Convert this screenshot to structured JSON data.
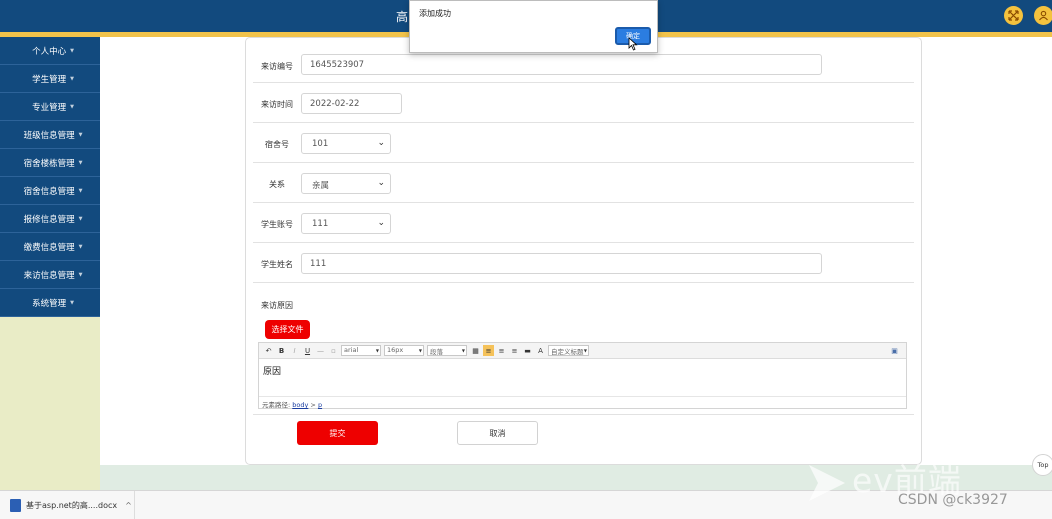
{
  "header": {
    "app_title": "高"
  },
  "sidebar": {
    "items": [
      {
        "label": "个人中心"
      },
      {
        "label": "学生管理"
      },
      {
        "label": "专业管理"
      },
      {
        "label": "班级信息管理"
      },
      {
        "label": "宿舍楼栋管理"
      },
      {
        "label": "宿舍信息管理"
      },
      {
        "label": "报修信息管理"
      },
      {
        "label": "缴费信息管理"
      },
      {
        "label": "来访信息管理"
      },
      {
        "label": "系统管理"
      }
    ]
  },
  "form": {
    "visit_no": {
      "label": "来访编号",
      "value": "1645523907"
    },
    "visit_time": {
      "label": "来访时间",
      "value": "2022-02-22"
    },
    "dorm_no": {
      "label": "宿舍号",
      "value": "101"
    },
    "relation": {
      "label": "关系",
      "value": "亲属"
    },
    "student_account": {
      "label": "学生账号",
      "value": "111"
    },
    "student_name": {
      "label": "学生姓名",
      "value": "111"
    },
    "reason": {
      "label": "来访原因"
    },
    "choose_file_label": "选择文件",
    "submit_label": "提交",
    "cancel_label": "取消"
  },
  "editor": {
    "font_family": "arial",
    "font_size": "16px",
    "paragraph": "段落",
    "custom_title": "自定义标题",
    "content": "原因",
    "path_prefix": "元素路径:",
    "path_body": "body",
    "path_sep": " > ",
    "path_p": "p"
  },
  "dialog": {
    "message": "添加成功",
    "ok_label": "确定"
  },
  "taskbar": {
    "download_name": "基于asp.net的高....docx"
  },
  "back_to_top": "Top",
  "watermark": {
    "logo_text": "ev前端",
    "csdn_text": "CSDN @ck3927"
  },
  "colors": {
    "header_bg": "#124a7e",
    "accent_red": "#ee0000",
    "stripe": "#f2c34a",
    "dialog_ok": "#2b7de1"
  }
}
